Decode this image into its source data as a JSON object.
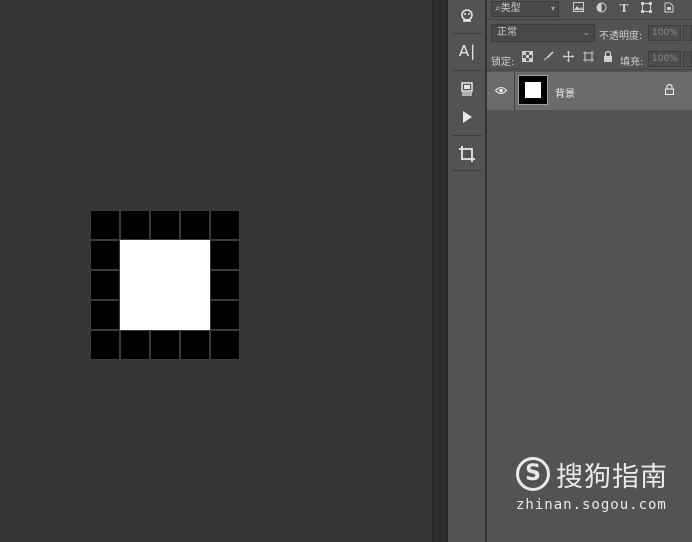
{
  "canvas": {
    "pixel_grid": {
      "rows": 5,
      "cols": 5,
      "cells": [
        [
          "black",
          "black",
          "black",
          "black",
          "black"
        ],
        [
          "black",
          "white",
          "white",
          "white",
          "black"
        ],
        [
          "black",
          "white",
          "white",
          "white",
          "black"
        ],
        [
          "black",
          "white",
          "white",
          "white",
          "black"
        ],
        [
          "black",
          "black",
          "black",
          "black",
          "black"
        ]
      ]
    },
    "background_color": "#363636"
  },
  "toolbar": {
    "tools": [
      {
        "name": "3d-object-icon",
        "glyph": "☃"
      },
      {
        "name": "character-panel-icon",
        "glyph": "A|"
      },
      {
        "name": "3d-mesh-icon",
        "glyph": "⧉"
      },
      {
        "name": "play-action-icon",
        "glyph": "▶"
      },
      {
        "name": "crop-icon",
        "glyph": "⌗"
      }
    ]
  },
  "layers_panel": {
    "filter": {
      "search_glyph": "⌕",
      "kind_label": "类型",
      "icons": [
        "image-filter-icon",
        "adjustment-filter-icon",
        "type-filter-icon",
        "shape-filter-icon",
        "smart-object-filter-icon"
      ],
      "type_glyph": "T"
    },
    "blend_mode": "正常",
    "opacity_label": "不透明度:",
    "opacity_value": "100%",
    "lock_label": "锁定:",
    "fill_label": "填充:",
    "fill_value": "100%",
    "layers": [
      {
        "name": "背景",
        "visible": true,
        "locked": true
      }
    ]
  },
  "watermark": {
    "logo_letter": "S",
    "brand": "搜狗指南",
    "url": "zhinan.sogou.com"
  }
}
